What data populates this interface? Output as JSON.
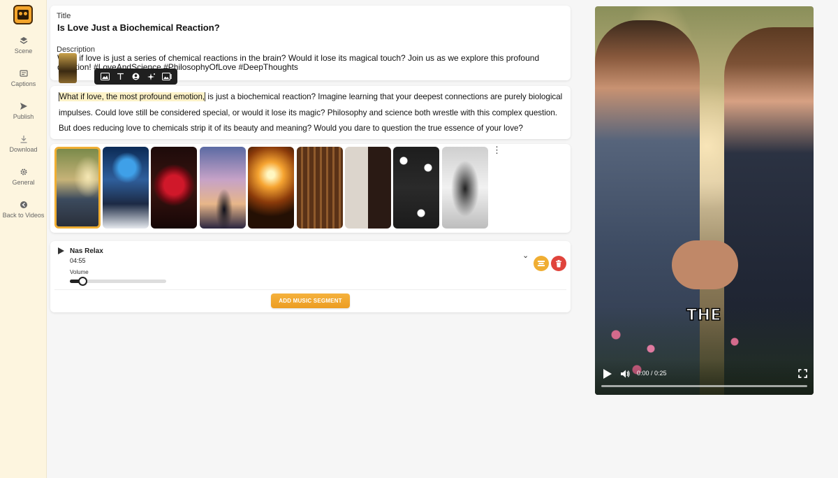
{
  "sidebar": {
    "items": [
      {
        "label": "Scene",
        "icon": "layers-icon"
      },
      {
        "label": "Captions",
        "icon": "captions-icon"
      },
      {
        "label": "Publish",
        "icon": "send-icon"
      },
      {
        "label": "Download",
        "icon": "download-icon"
      },
      {
        "label": "General",
        "icon": "gear-icon"
      },
      {
        "label": "Back to Videos",
        "icon": "back-arrow-icon"
      }
    ]
  },
  "meta": {
    "title_label": "Title",
    "title_value": "Is Love Just a Biochemical Reaction?",
    "description_label": "Description",
    "description_value": "What if love is just a series of chemical reactions in the brain? Would it lose its magical touch? Join us as we explore this profound question! #LoveAndScience #PhilosophyOfLove #DeepThoughts"
  },
  "toolbar": {
    "tools": [
      "image-gallery-icon",
      "text-icon",
      "face-icon",
      "sparkle-icon",
      "image-swap-icon"
    ]
  },
  "script": {
    "highlighted": "What if love, the most profound emotion,",
    "rest": " is just a biochemical reaction? Imagine learning that your deepest connections are purely biological impulses. Could love still be considered special, or would it lose its magic? Philosophy and science both wrestle with this complex question. But does reducing love to chemicals strip it of its beauty and meaning? Would you dare to question the true essence of your love?"
  },
  "scenes": {
    "count": 9,
    "selected_index": 0
  },
  "music": {
    "track_name": "Nas Relax",
    "duration": "04:55",
    "volume_label": "Volume",
    "volume_level": 0.13,
    "add_button": "ADD MUSIC SEGMENT"
  },
  "video": {
    "caption_word": "THE",
    "time": "0:00 / 0:25",
    "progress": 0.0
  },
  "colors": {
    "accent": "#f0ae33",
    "delete": "#e0443c",
    "sidebar_bg": "#fdf5df"
  }
}
